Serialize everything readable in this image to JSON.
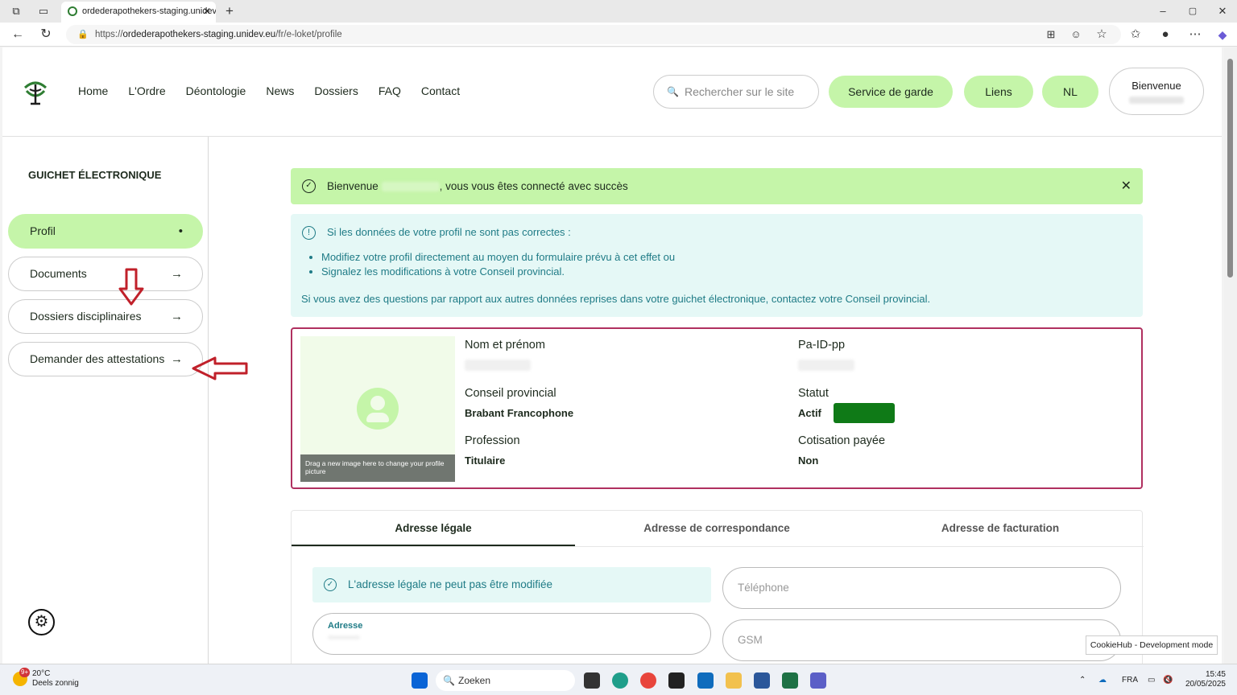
{
  "browser": {
    "tab_title": "ordederapothekers-staging.unidev.eu",
    "url_prefix": "https://",
    "url_domain": "ordederapothekers-staging.unidev.eu",
    "url_path": "/fr/e-loket/profile"
  },
  "header": {
    "nav": [
      "Home",
      "L'Ordre",
      "Déontologie",
      "News",
      "Dossiers",
      "FAQ",
      "Contact"
    ],
    "search_placeholder": "Rechercher sur le site",
    "service_button": "Service de garde",
    "links_button": "Liens",
    "lang_button": "NL",
    "welcome_label": "Bienvenue"
  },
  "sidebar": {
    "title": "GUICHET ÉLECTRONIQUE",
    "items": [
      {
        "label": "Profil",
        "end": "•"
      },
      {
        "label": "Documents",
        "end": "→"
      },
      {
        "label": "Dossiers disciplinaires",
        "end": "→"
      },
      {
        "label": "Demander des attestations",
        "end": "→"
      }
    ]
  },
  "success_alert": {
    "prefix": "Bienvenue",
    "suffix": ", vous vous êtes connecté avec succès",
    "close": "✕"
  },
  "info_alert": {
    "head": "Si les données de votre profil ne sont pas correctes :",
    "items": [
      "Modifiez votre profil directement au moyen du formulaire prévu à cet effet ou",
      "Signalez les modifications à votre Conseil provincial."
    ],
    "footer": "Si vous avez des questions par rapport aux autres données reprises dans votre guichet électronique, contactez votre Conseil provincial."
  },
  "profile": {
    "photo_caption": "Drag a new image here to change your profile picture",
    "name_label": "Nom et prénom",
    "id_label": "Pa-ID-pp",
    "council_label": "Conseil provincial",
    "council_value": "Brabant Francophone",
    "status_label": "Statut",
    "status_value": "Actif",
    "status_badge_color": "#0f7a17",
    "profession_label": "Profession",
    "profession_value": "Titulaire",
    "fee_label": "Cotisation payée",
    "fee_value": "Non"
  },
  "address_tabs": {
    "tabs": [
      "Adresse légale",
      "Adresse de correspondance",
      "Adresse de facturation"
    ],
    "active_tab": "Adresse légale",
    "notice": "L'adresse légale ne peut pas être modifiée",
    "address_label": "Adresse",
    "phone_placeholder": "Téléphone",
    "gsm_placeholder": "GSM"
  },
  "cookie_badge": "CookieHub - Development mode",
  "taskbar": {
    "weather_temp": "20°C",
    "weather_desc": "Deels zonnig",
    "weather_badge": "9+",
    "search_label": "Zoeken",
    "lang": "FRA",
    "time": "15:45",
    "date": "20/05/2025"
  },
  "colors": {
    "accent_green": "#c5f5a9",
    "info_teal": "#1f7b86",
    "card_border": "#b03060",
    "annotation_red": "#c0202a"
  }
}
